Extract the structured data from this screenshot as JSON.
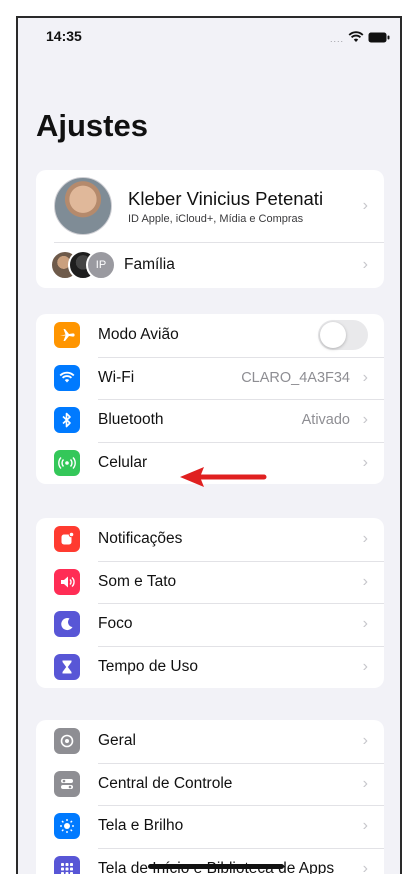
{
  "status_bar": {
    "time": "14:35",
    "signal_dots": "....",
    "wifi_icon": "wifi-icon",
    "battery_icon": "battery-icon"
  },
  "page_title": "Ajustes",
  "profile": {
    "name": "Kleber Vinicius  Petenati",
    "subtitle": "ID Apple, iCloud+, Mídia e Compras",
    "family_label": "Família",
    "family_initials": "IP"
  },
  "group1": {
    "items": [
      {
        "label": "Modo Avião",
        "icon": "airplane-icon",
        "color": "#ff9500",
        "toggle_on": false
      },
      {
        "label": "Wi-Fi",
        "icon": "wifi-icon",
        "color": "#007aff",
        "value": "CLARO_4A3F34"
      },
      {
        "label": "Bluetooth",
        "icon": "bluetooth-icon",
        "color": "#007aff",
        "value": "Ativado"
      },
      {
        "label": "Celular",
        "icon": "cellular-icon",
        "color": "#34c759"
      }
    ]
  },
  "group2": {
    "items": [
      {
        "label": "Notificações",
        "icon": "notifications-icon",
        "color": "#ff3b30"
      },
      {
        "label": "Som e Tato",
        "icon": "speaker-icon",
        "color": "#ff2d55"
      },
      {
        "label": "Foco",
        "icon": "moon-icon",
        "color": "#5856d6"
      },
      {
        "label": "Tempo de Uso",
        "icon": "hourglass-icon",
        "color": "#5856d6"
      }
    ]
  },
  "group3": {
    "items": [
      {
        "label": "Geral",
        "icon": "gear-icon",
        "color": "#8e8e93"
      },
      {
        "label": "Central de Controle",
        "icon": "switches-icon",
        "color": "#8e8e93"
      },
      {
        "label": "Tela e Brilho",
        "icon": "brightness-icon",
        "color": "#007aff"
      },
      {
        "label": "Tela de Início e Biblioteca de Apps",
        "icon": "home-grid-icon",
        "color": "#5856d6"
      }
    ]
  },
  "annotation": {
    "arrow_color": "#e02020"
  }
}
